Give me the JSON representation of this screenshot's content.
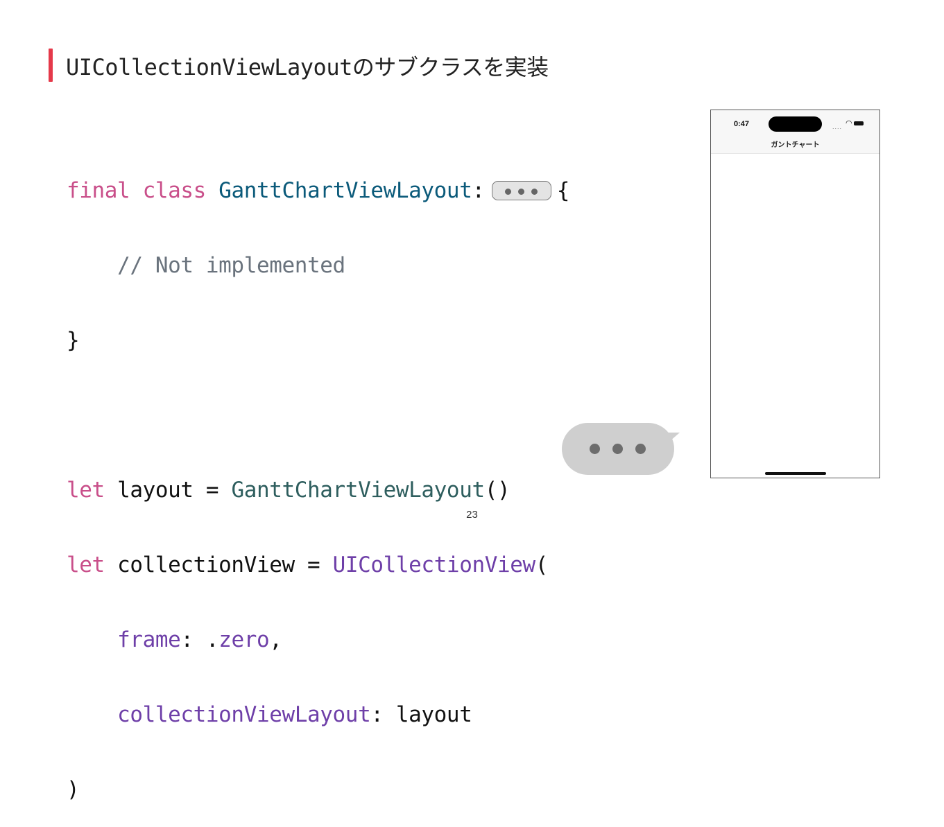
{
  "slide": {
    "title": "UICollectionViewLayoutのサブクラスを実装",
    "page_number": "23"
  },
  "code": {
    "l1_kw1": "final",
    "l1_kw2": "class",
    "l1_type": "GanttChartViewLayout",
    "l1_colon": ":",
    "l1_brace": "{",
    "l2_comment": "// Not implemented",
    "l3_brace": "}",
    "l5_kw": "let",
    "l5_name": "layout",
    "l5_eq": "=",
    "l5_type": "GanttChartViewLayout",
    "l5_call": "()",
    "l6_kw": "let",
    "l6_name": "collectionView",
    "l6_eq": "=",
    "l6_type": "UICollectionView",
    "l6_paren": "(",
    "l7_param": "frame",
    "l7_colon": ":",
    "l7_dot": ".",
    "l7_value": "zero",
    "l7_comma": ",",
    "l8_param": "collectionViewLayout",
    "l8_colon": ":",
    "l8_value": "layout",
    "l9_paren": ")"
  },
  "phone": {
    "time": "0:47",
    "signal": "....",
    "wifi": "wifi-icon",
    "battery": "battery-icon",
    "nav_title": "ガントチャート"
  },
  "colors": {
    "accent": "#e5394a",
    "keyword": "#c94f8a",
    "type_def": "#0b5a7a",
    "type_use": "#2e5e5e",
    "system_type": "#6e3fa8",
    "comment": "#6a737d",
    "bubble": "#cfcfcf"
  }
}
